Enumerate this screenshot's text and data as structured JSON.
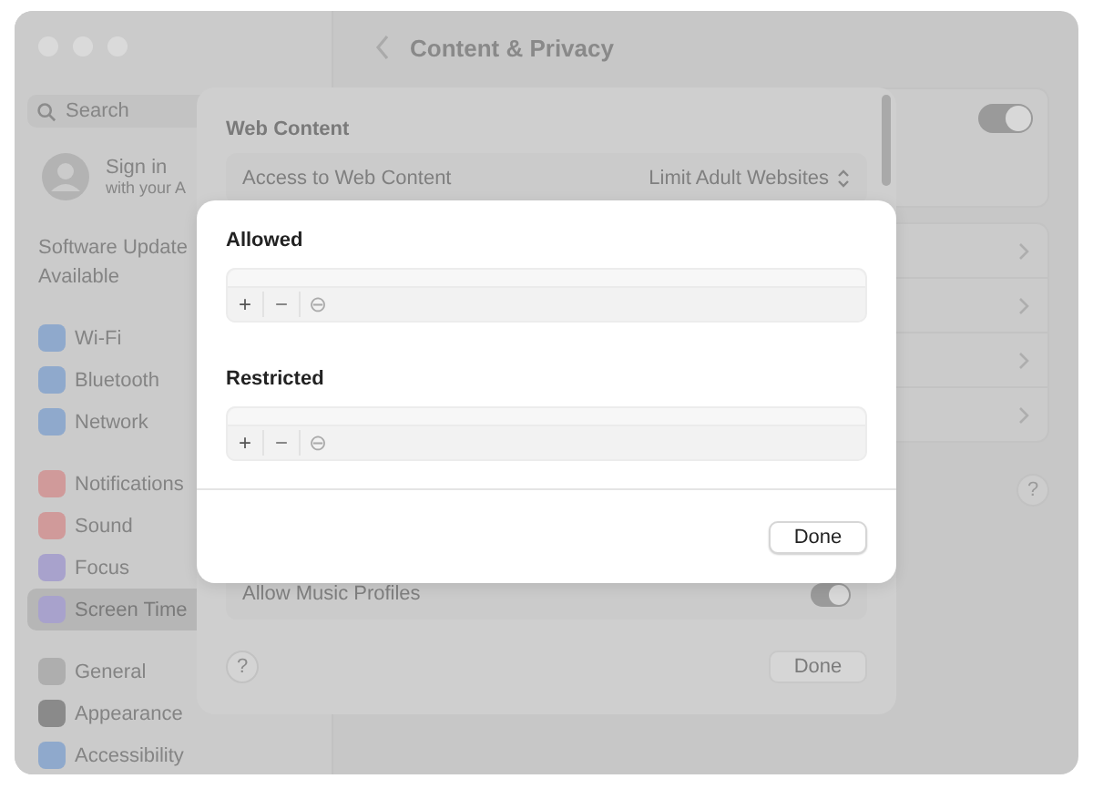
{
  "window": {
    "title": "Content & Privacy"
  },
  "sidebar": {
    "search": {
      "placeholder": "Search"
    },
    "account": {
      "title": "Sign in",
      "subtitle": "with your A"
    },
    "notice": "Software Update Available",
    "groups": [
      [
        {
          "label": "Wi-Fi",
          "color": "#8fa9cc",
          "selected": false
        },
        {
          "label": "Bluetooth",
          "color": "#8fa9cc",
          "selected": false
        },
        {
          "label": "Network",
          "color": "#8fa9cc",
          "selected": false
        }
      ],
      [
        {
          "label": "Notifications",
          "color": "#d09a9a",
          "selected": false
        },
        {
          "label": "Sound",
          "color": "#d09a9a",
          "selected": false
        },
        {
          "label": "Focus",
          "color": "#a8a2cc",
          "selected": false
        },
        {
          "label": "Screen Time",
          "color": "#a8a2cc",
          "selected": true
        }
      ],
      [
        {
          "label": "General",
          "color": "#aeaeae",
          "selected": false
        },
        {
          "label": "Appearance",
          "color": "#8a8a8a",
          "selected": false
        },
        {
          "label": "Accessibility",
          "color": "#8fa9cc",
          "selected": false
        }
      ]
    ]
  },
  "content": {
    "toggle_on": true,
    "link_rows": [
      {
        "kind": "chevron"
      },
      {
        "kind": "chevron"
      },
      {
        "kind": "chevron"
      },
      {
        "kind": "chevron"
      }
    ],
    "help": "?"
  },
  "web_sheet": {
    "title": "Web Content",
    "access": {
      "label": "Access to Web Content",
      "value": "Limit Adult Websites"
    },
    "music": {
      "label": "Allow Music Profiles",
      "on": true
    },
    "help": "?",
    "done": "Done"
  },
  "list_sheet": {
    "sections": [
      {
        "title": "Allowed",
        "tools": [
          "+",
          "−",
          "⊖"
        ]
      },
      {
        "title": "Restricted",
        "tools": [
          "+",
          "−",
          "⊖"
        ]
      }
    ],
    "done": "Done"
  }
}
